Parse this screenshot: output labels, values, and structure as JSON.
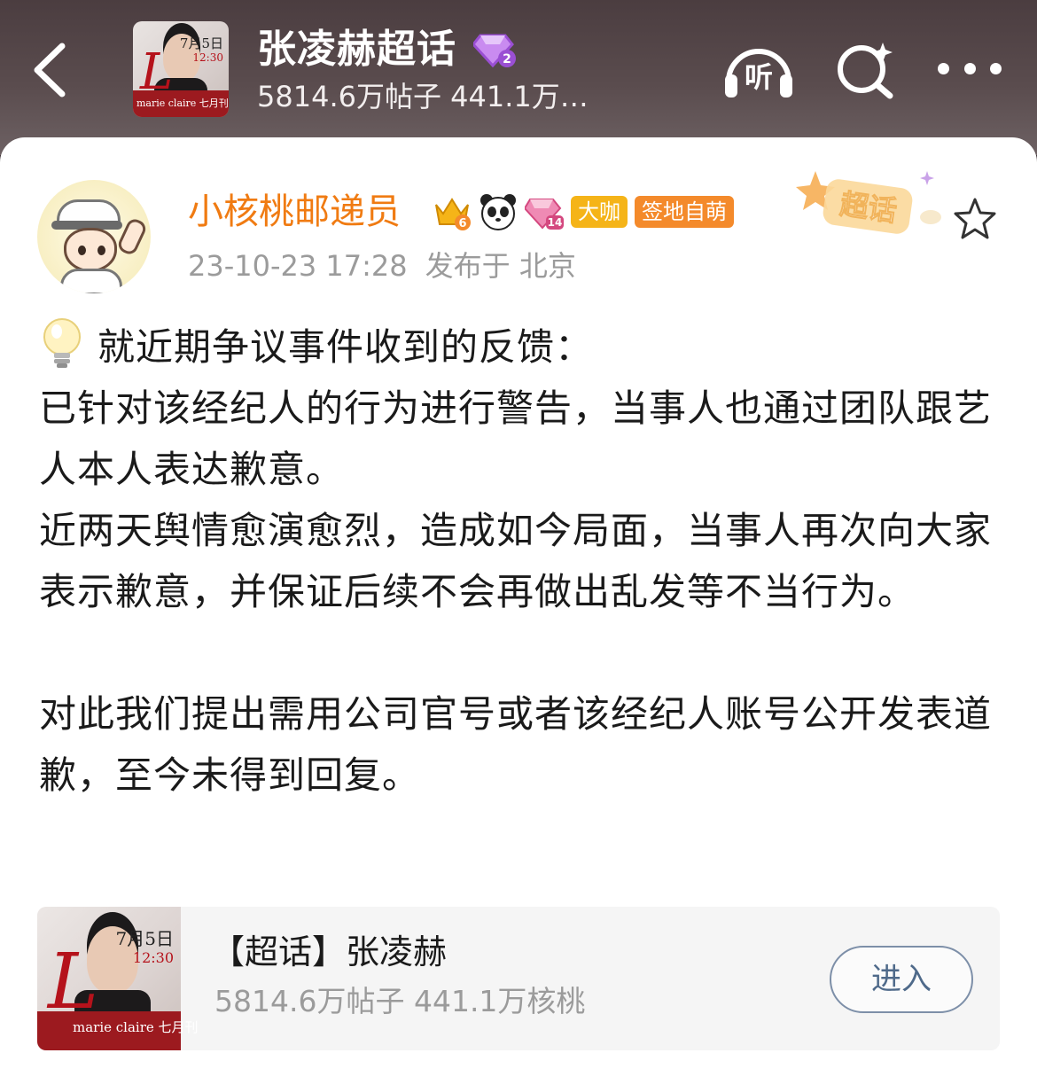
{
  "header": {
    "title": "张凌赫超话",
    "stats": "5814.6万帖子 441.1万…",
    "level_badge_text": "2",
    "listen_label": "听"
  },
  "topic_thumb": {
    "date_text": "7月5日",
    "time_text": "12:30",
    "brand_text": "marie claire 七月刊"
  },
  "post": {
    "user_name": "小核桃邮递员",
    "badges": {
      "crown_level": "6",
      "diamond_level": "14",
      "tag_dk": "大咖",
      "tag_qd": "签地自萌"
    },
    "timestamp": "23-10-23 17:28",
    "location": "发布于 北京",
    "stamp_label": "超话",
    "paragraphs": [
      "就近期争议事件收到的反馈：",
      "已针对该经纪人的行为进行警告，当事人也通过团队跟艺人本人表达歉意。",
      "近两天舆情愈演愈烈，造成如今局面，当事人再次向大家表示歉意，并保证后续不会再做出乱发等不当行为。",
      "对此我们提出需用公司官号或者该经纪人账号公开发表道歉，至今未得到回复。"
    ]
  },
  "topic_card": {
    "title": "【超话】张凌赫",
    "stats": "5814.6万帖子 441.1万核桃",
    "enter_label": "进入"
  },
  "colors": {
    "header_bg": "#4b3d40",
    "username": "#f07b12",
    "meta": "#9b9b9b",
    "tag_dk": "#f5b418",
    "tag_qd": "#f48a2b",
    "enter_border": "#7d8fa8"
  },
  "icons": {
    "back": "chevron-left-icon",
    "listen": "headphones-icon",
    "search": "search-sparkle-icon",
    "more": "more-dots-icon",
    "favorite": "star-icon",
    "bulb": "light-bulb-icon"
  }
}
